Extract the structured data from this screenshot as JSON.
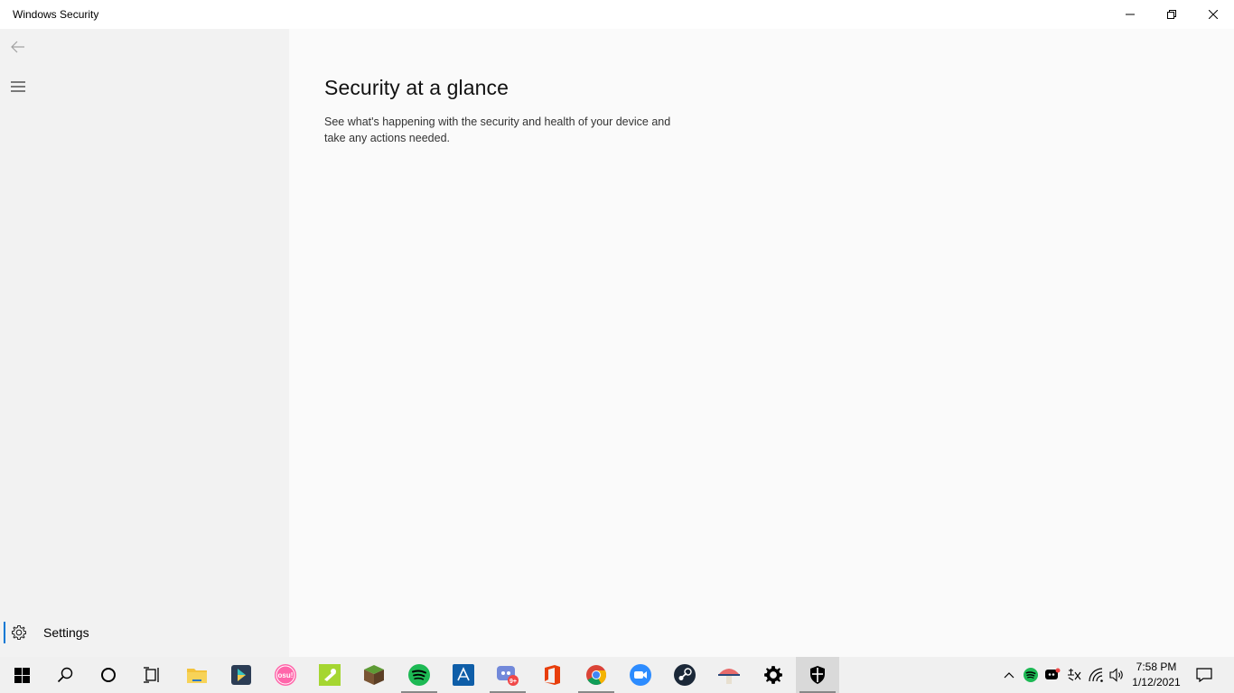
{
  "window": {
    "title": "Windows Security",
    "controls": {
      "minimize": "minimize-icon",
      "maximize": "restore-icon",
      "close": "close-icon"
    }
  },
  "sidebar": {
    "back_icon": "back-arrow-icon",
    "menu_icon": "hamburger-icon",
    "settings": {
      "label": "Settings",
      "icon": "gear-icon",
      "accent": "#0078d4"
    }
  },
  "main": {
    "title": "Security at a glance",
    "description": "See what's happening with the security and health of your device and take any actions needed."
  },
  "taskbar": {
    "apps": [
      {
        "name": "start",
        "icon": "windows-logo-icon"
      },
      {
        "name": "search",
        "icon": "search-icon"
      },
      {
        "name": "cortana",
        "icon": "cortana-circle-icon"
      },
      {
        "name": "task-view",
        "icon": "task-view-icon"
      },
      {
        "name": "file-explorer",
        "icon": "folder-icon"
      },
      {
        "name": "app-dark",
        "icon": "app-icon"
      },
      {
        "name": "osu",
        "icon": "osu-icon",
        "text": "osu!"
      },
      {
        "name": "app-green",
        "icon": "app-icon"
      },
      {
        "name": "minecraft",
        "icon": "minecraft-icon"
      },
      {
        "name": "spotify",
        "icon": "spotify-icon"
      },
      {
        "name": "app-blue",
        "icon": "app-icon"
      },
      {
        "name": "discord",
        "icon": "discord-icon",
        "badge": "9+"
      },
      {
        "name": "office",
        "icon": "office-icon"
      },
      {
        "name": "chrome",
        "icon": "chrome-icon"
      },
      {
        "name": "zoom",
        "icon": "zoom-icon"
      },
      {
        "name": "steam",
        "icon": "steam-icon"
      },
      {
        "name": "app-mushroom",
        "icon": "app-icon"
      },
      {
        "name": "settings",
        "icon": "gear-icon"
      },
      {
        "name": "windows-security",
        "icon": "shield-icon"
      }
    ],
    "tray": {
      "chevron": "chevron-up-icon",
      "spotify": "spotify-icon",
      "discord": "discord-icon",
      "ime": "input-method-icon",
      "network": "wifi-icon",
      "volume": "speaker-icon",
      "notifications": "notification-icon"
    },
    "clock": {
      "time": "7:58 PM",
      "date": "1/12/2021"
    }
  }
}
